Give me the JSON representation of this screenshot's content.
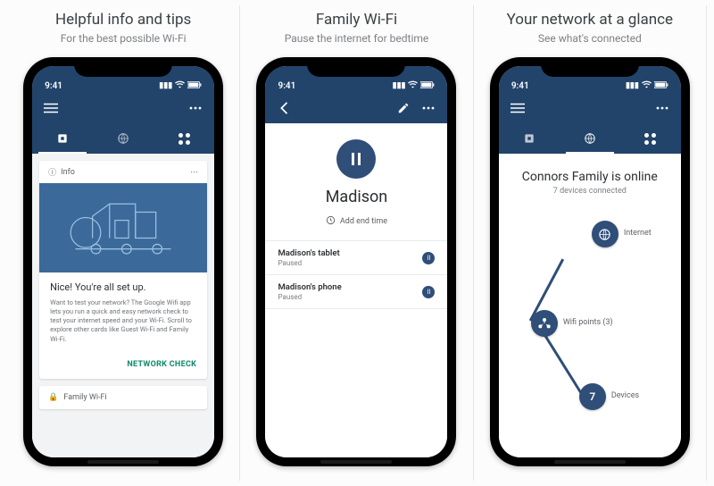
{
  "colors": {
    "brand": "#22446b",
    "brand2": "#2f4e78",
    "accent": "#0f8a6d"
  },
  "status_time": "9:41",
  "panels": [
    {
      "title": "Helpful info and tips",
      "subtitle": "For the best possible Wi-Fi"
    },
    {
      "title": "Family Wi-Fi",
      "subtitle": "Pause the internet for bedtime"
    },
    {
      "title": "Your network at a glance",
      "subtitle": "See what's connected"
    }
  ],
  "screen1": {
    "info_label": "Info",
    "card_title": "Nice! You're all set up.",
    "card_text": "Want to test your network? The Google Wifi app lets you run a quick and easy network check to test your internet speed and your Wi-Fi. Scroll to explore other cards like Guest Wi-Fi and Family Wi-Fi.",
    "action": "NETWORK CHECK",
    "next_card": "Family Wi-Fi"
  },
  "screen2": {
    "name": "Madison",
    "add_end_time": "Add end time",
    "devices": [
      {
        "name": "Madison's tablet",
        "status": "Paused"
      },
      {
        "name": "Madison's phone",
        "status": "Paused"
      }
    ]
  },
  "screen3": {
    "headline": "Connors Family is online",
    "sub": "7 devices connected",
    "nodes": {
      "internet": "Internet",
      "points": "Wifi points (3)",
      "devices_count": "7",
      "devices_label": "Devices"
    }
  }
}
